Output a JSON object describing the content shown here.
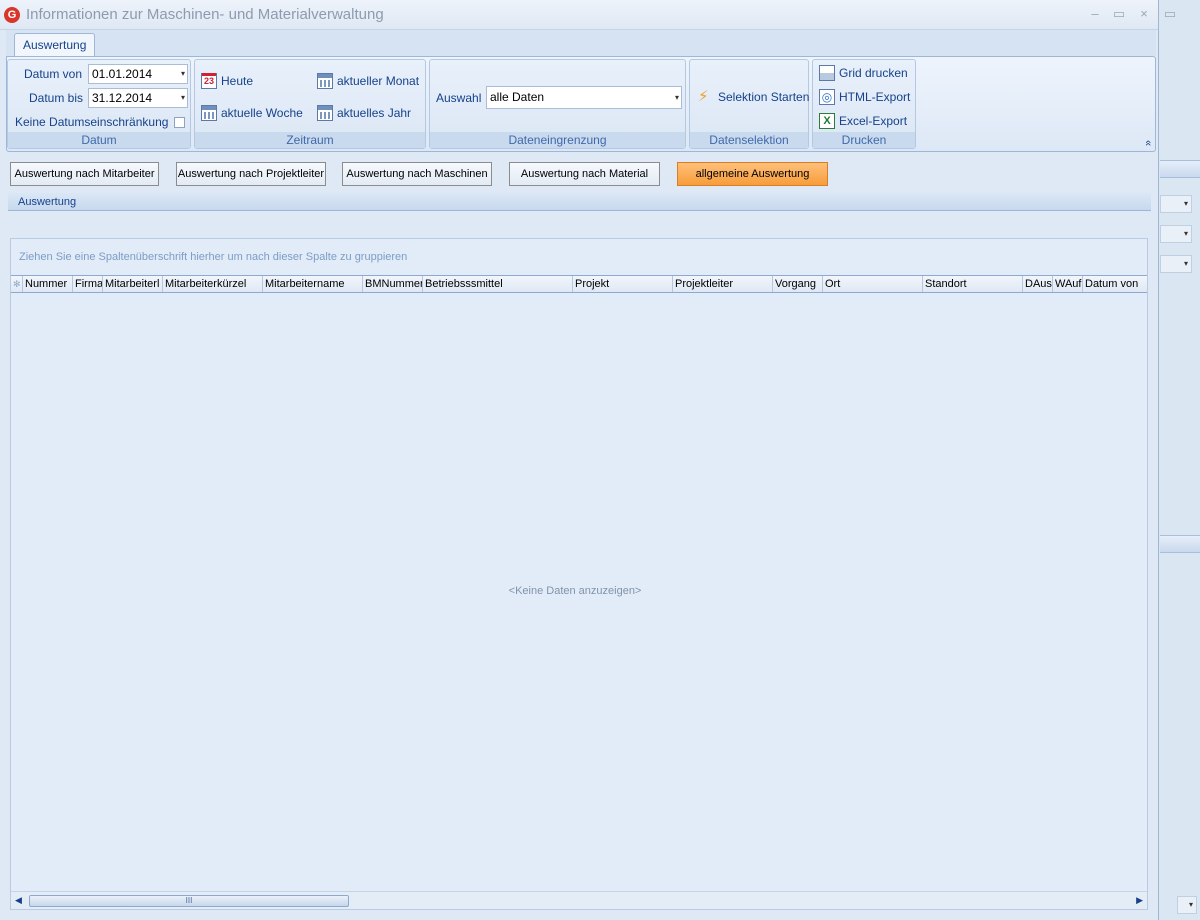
{
  "window": {
    "title": "Informationen zur Maschinen- und Materialverwaltung",
    "minimize": "–",
    "maximize": "▭",
    "close": "×"
  },
  "ribbon": {
    "tab": "Auswertung",
    "datum": {
      "label_von": "Datum von",
      "value_von": "01.01.2014",
      "label_bis": "Datum bis",
      "value_bis": "31.12.2014",
      "keine_label": "Keine Datumseinschränkung",
      "keine_checked": false,
      "group_label": "Datum"
    },
    "zeitraum": {
      "heute": "Heute",
      "aktuelle_woche": "aktuelle Woche",
      "aktueller_monat": "aktueller Monat",
      "aktuelles_jahr": "aktuelles Jahr",
      "calendar_day": "23",
      "group_label": "Zeitraum"
    },
    "dateneingrenzung": {
      "auswahl_label": "Auswahl",
      "auswahl_value": "alle Daten",
      "group_label": "Dateneingrenzung"
    },
    "datenselektion": {
      "selektion_starten": "Selektion Starten",
      "group_label": "Datenselektion"
    },
    "drucken": {
      "grid_drucken": "Grid drucken",
      "html_export": "HTML-Export",
      "excel_export": "Excel-Export",
      "group_label": "Drucken"
    },
    "collapse_icon": "«"
  },
  "evaluation_buttons": [
    "Auswertung nach Mitarbeiter",
    "Auswertung nach Projektleiter",
    "Auswertung nach Maschinen",
    "Auswertung nach Material",
    "allgemeine Auswertung"
  ],
  "active_evaluation": "allgemeine Auswertung",
  "section": {
    "title": "Auswertung"
  },
  "grid": {
    "group_panel_text": "Ziehen Sie eine Spaltenüberschrift hierher um nach dieser Spalte zu gruppieren",
    "columns": [
      "Nummer",
      "Firma",
      "Mitarbeiterl",
      "Mitarbeiterkürzel",
      "Mitarbeitername",
      "BMNummer",
      "Betriebsssmittel",
      "Projekt",
      "Projektleiter",
      "Vorgang",
      "Ort",
      "Standort",
      "DAus",
      "WAuf",
      "Datum von"
    ],
    "empty_text": "<Keine Daten anzuzeigen>",
    "scroll_thumb": "III"
  },
  "colors": {
    "accent": "#15428b",
    "active_button": "#f79d3a",
    "ribbon_bg": "#dde8f6"
  }
}
